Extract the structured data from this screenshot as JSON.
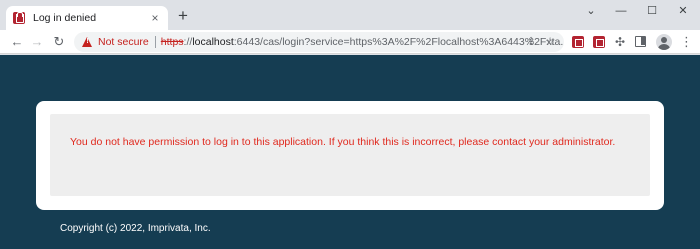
{
  "browser": {
    "tab": {
      "title": "Log in denied",
      "close_glyph": "×",
      "icon": "imprivata-favicon"
    },
    "new_tab_glyph": "+",
    "window_controls": {
      "collapse": "⌄",
      "minimize": "—",
      "maximize": "☐",
      "close": "✕"
    },
    "nav": {
      "back": "←",
      "forward": "→",
      "reload": "↻"
    },
    "address": {
      "security_label": "Not secure",
      "scheme": "https",
      "scheme_sep": "://",
      "host": "localhost",
      "path": ":6443/cas/login?service=https%3A%2F%2Flocalhost%3A6443%2Fxta..."
    },
    "share_glyph": "⇪",
    "star_glyph": "☆",
    "puzzle_glyph": "✣",
    "menu_glyph": "⋮"
  },
  "page": {
    "message": "You do not have permission to log in to this application. If you think this is incorrect, please contact your administrator.",
    "copyright": "Copyright (c) 2022, Imprivata, Inc."
  },
  "colors": {
    "page_background": "#153d52",
    "error_text": "#e0291e",
    "alert_background": "#eeeeee",
    "brand_red": "#b32431"
  }
}
